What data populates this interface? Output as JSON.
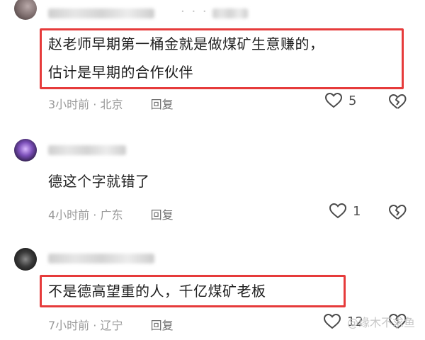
{
  "comments": [
    {
      "text_lines": [
        "赵老师早期第一桶金就是做煤矿生意赚的，",
        "估计是早期的合作伙伴"
      ],
      "time": "3小时前",
      "location": "北京",
      "reply": "回复",
      "likes": "5"
    },
    {
      "text_lines": [
        "德这个字就错了"
      ],
      "time": "4小时前",
      "location": "广东",
      "reply": "回复",
      "likes": "1"
    },
    {
      "text_lines": [
        "不是德高望重的人，千亿煤矿老板"
      ],
      "time": "7小时前",
      "location": "辽宁",
      "reply": "回复",
      "likes": "12"
    }
  ],
  "watermark": "@缘木不求鱼",
  "icons": {
    "like": "heart-outline-icon",
    "dislike": "broken-heart-outline-icon",
    "more": "more-dots-icon"
  },
  "colors": {
    "highlight_border": "#e63b3b",
    "meta_text": "#9a9a9a",
    "icon_stroke": "#4a4a4a"
  }
}
